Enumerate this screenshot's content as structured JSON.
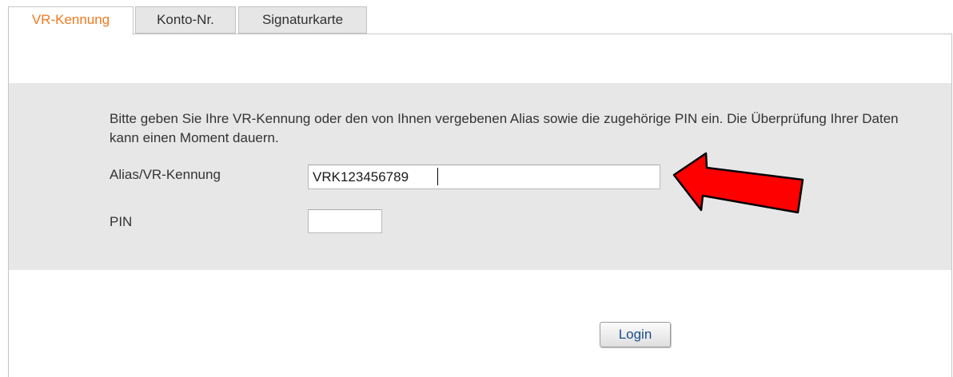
{
  "tabs": [
    {
      "label": "VR-Kennung",
      "active": true
    },
    {
      "label": "Konto-Nr.",
      "active": false
    },
    {
      "label": "Signaturkarte",
      "active": false
    }
  ],
  "form": {
    "intro": "Bitte geben Sie Ihre VR-Kennung oder den von Ihnen vergebenen Alias sowie die zugehörige PIN ein. Die Überprüfung Ihrer Daten kann einen Moment dauern.",
    "alias_label": "Alias/VR-Kennung",
    "alias_value": "VRK123456789",
    "pin_label": "PIN",
    "pin_value": ""
  },
  "login_button": "Login",
  "colors": {
    "active_tab_text": "#f0791e",
    "panel_background": "#e7e7e7",
    "arrow_fill": "#ff0000",
    "button_text": "#174f8f"
  },
  "icons": {
    "annotation": "red-arrow-icon"
  }
}
